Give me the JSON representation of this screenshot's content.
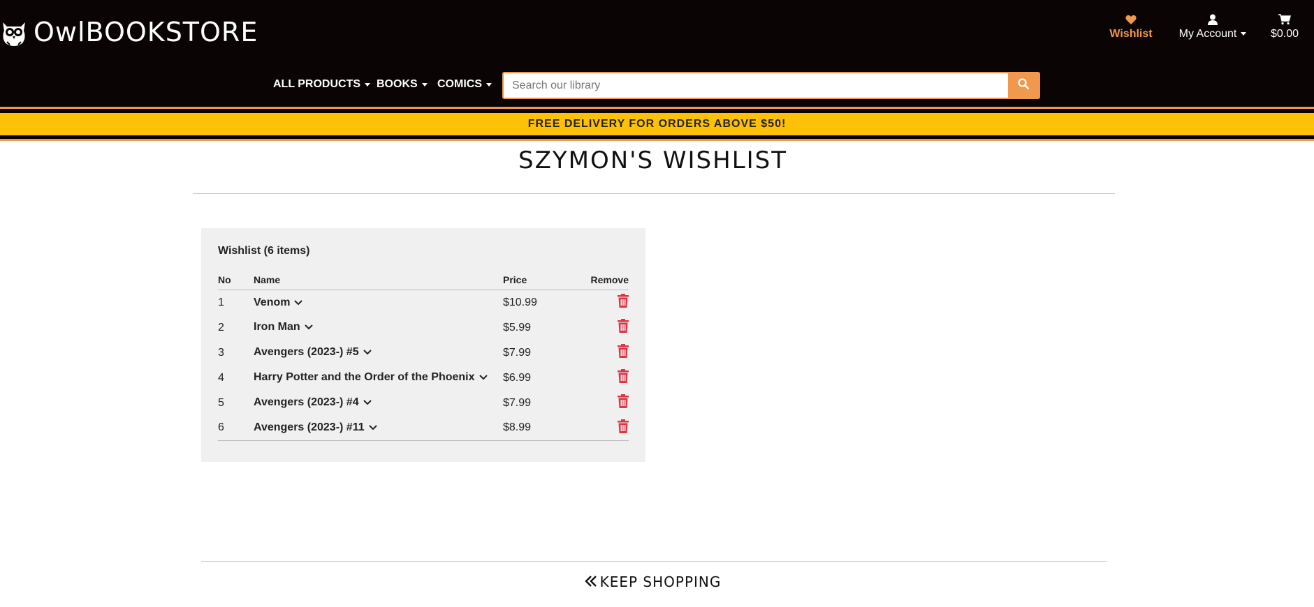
{
  "header": {
    "logo_text": "OwlBOOKSTORE",
    "wishlist_label": "Wishlist",
    "account_label": "My Account",
    "cart_total": "$0.00"
  },
  "nav": {
    "items": [
      {
        "label": "ALL PRODUCTS"
      },
      {
        "label": "BOOKS"
      },
      {
        "label": "COMICS"
      }
    ],
    "search_placeholder": "Search our library"
  },
  "banner": {
    "text": "FREE DELIVERY FOR ORDERS ABOVE $50!"
  },
  "page": {
    "title": "SZYMON'S WISHLIST"
  },
  "wishlist": {
    "heading": "Wishlist (6 items)",
    "columns": {
      "no": "No",
      "name": "Name",
      "price": "Price",
      "remove": "Remove"
    },
    "rows": [
      {
        "no": "1",
        "name": "Venom",
        "price": "$10.99"
      },
      {
        "no": "2",
        "name": "Iron Man",
        "price": "$5.99"
      },
      {
        "no": "3",
        "name": "Avengers (2023-) #5",
        "price": "$7.99"
      },
      {
        "no": "4",
        "name": "Harry Potter and the Order of the Phoenix",
        "price": "$6.99"
      },
      {
        "no": "5",
        "name": "Avengers (2023-) #4",
        "price": "$7.99"
      },
      {
        "no": "6",
        "name": "Avengers (2023-) #11",
        "price": "$8.99"
      }
    ]
  },
  "footer": {
    "keep_shopping": "KEEP SHOPPING"
  },
  "colors": {
    "accent": "#f0984e",
    "banner": "#ffc107",
    "header_bg": "#0a0404",
    "danger": "#dc3545"
  },
  "icons": [
    "owl-logo-icon",
    "heart-icon",
    "user-icon",
    "cart-icon",
    "search-icon",
    "chevron-down-icon",
    "trash-icon",
    "double-chevron-left-icon"
  ]
}
